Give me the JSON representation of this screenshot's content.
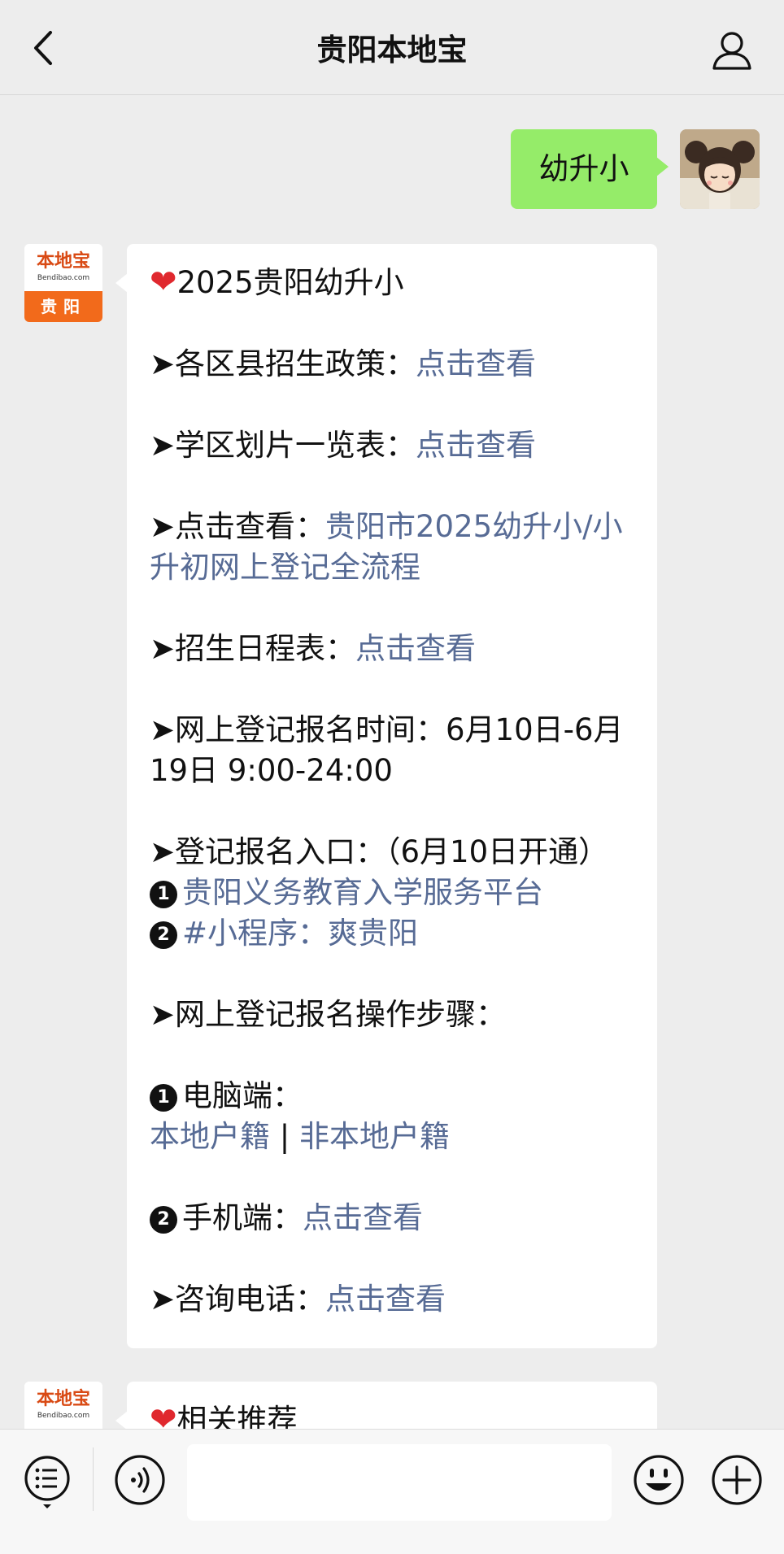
{
  "header": {
    "title": "贵阳本地宝",
    "back_icon": "chevron-left-icon",
    "profile_icon": "person-icon"
  },
  "messages": {
    "user_message": "幼升小",
    "bot_logo": {
      "brand": "本地宝",
      "domain": "Bendibao.com",
      "city": "贵阳"
    },
    "reply": {
      "heading": "2025贵阳幼升小",
      "policy_label": "➤各区县招生政策：",
      "policy_link": "点击查看",
      "district_label": "➤学区划片一览表：",
      "district_link": "点击查看",
      "process_label": "➤点击查看：",
      "process_link": "贵阳市2025幼升小/小升初网上登记全流程",
      "schedule_label": "➤招生日程表：",
      "schedule_link": "点击查看",
      "time_text": "➤网上登记报名时间：6月10日-6月19日 9:00-24:00",
      "entry_label": "➤登记报名入口：（6月10日开通）",
      "entry_1_num": "1",
      "entry_1_link": "贵阳义务教育入学服务平台",
      "entry_2_num": "2",
      "entry_2_link": "#小程序：爽贵阳",
      "steps_label": "➤网上登记报名操作步骤：",
      "pc_num": "1",
      "pc_label": "电脑端：",
      "local_link": "本地户籍",
      "separator": "|",
      "nonlocal_link": "非本地户籍",
      "mobile_num": "2",
      "mobile_label": "手机端：",
      "mobile_link": "点击查看",
      "phone_label": "➤咨询电话：",
      "phone_link": "点击查看"
    },
    "next_heading": "相关推荐"
  },
  "input_bar": {
    "placeholder": "",
    "icons": [
      "menu-icon",
      "voice-icon",
      "emoji-icon",
      "plus-icon"
    ]
  },
  "colors": {
    "background": "#ededed",
    "user_bubble": "#95ec69",
    "link": "#576b95",
    "heart": "#e0282e",
    "logo_orange": "#f26a1b"
  }
}
